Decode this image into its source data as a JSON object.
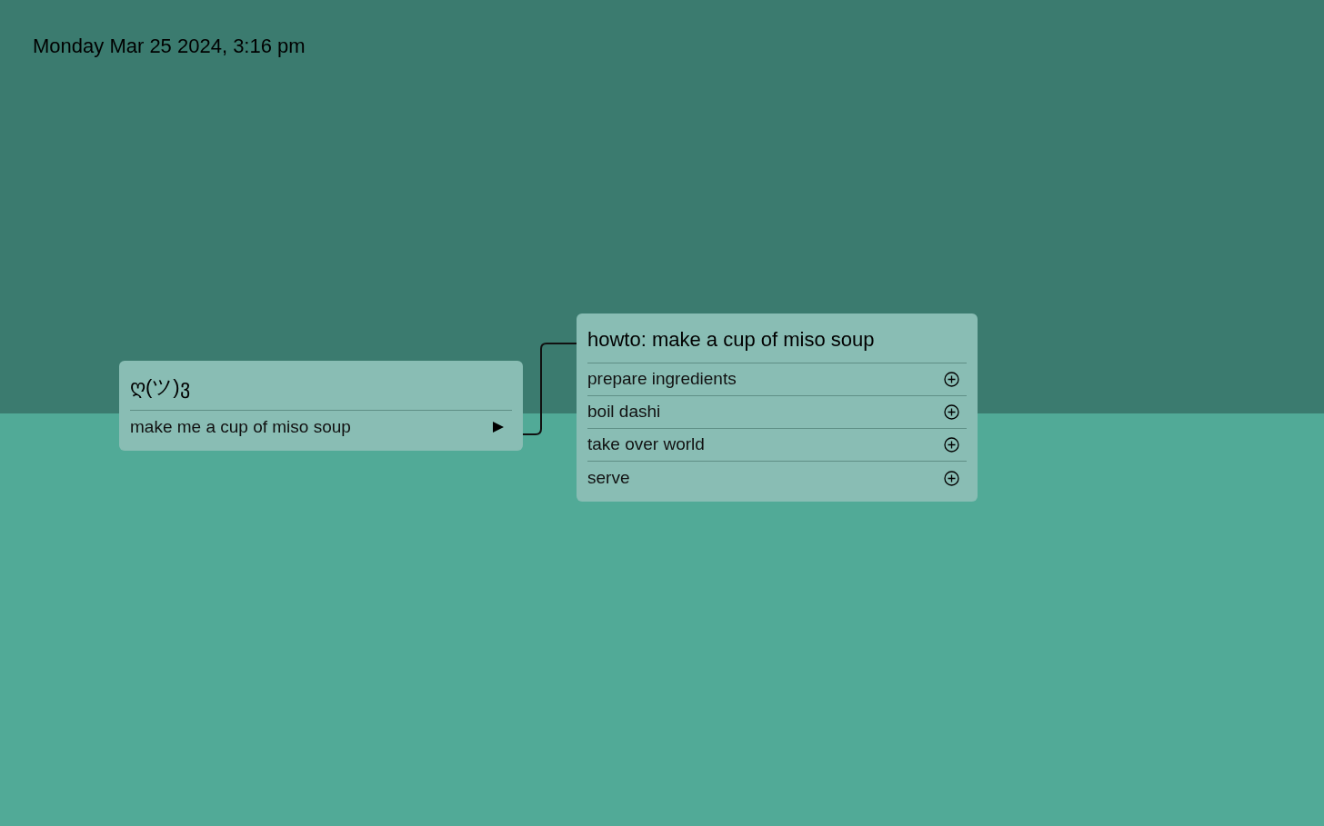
{
  "datetime": "Monday Mar 25 2024, 3:16 pm",
  "nodes": [
    {
      "title": "ღ(ツ)ვ",
      "items": [
        {
          "label": "make me a cup of miso soup",
          "kind": "link"
        }
      ]
    },
    {
      "title": "howto: make a cup of miso soup",
      "items": [
        {
          "label": "prepare ingredients",
          "kind": "add"
        },
        {
          "label": "boil dashi",
          "kind": "add"
        },
        {
          "label": "take over world",
          "kind": "add"
        },
        {
          "label": "serve",
          "kind": "add"
        }
      ]
    }
  ]
}
